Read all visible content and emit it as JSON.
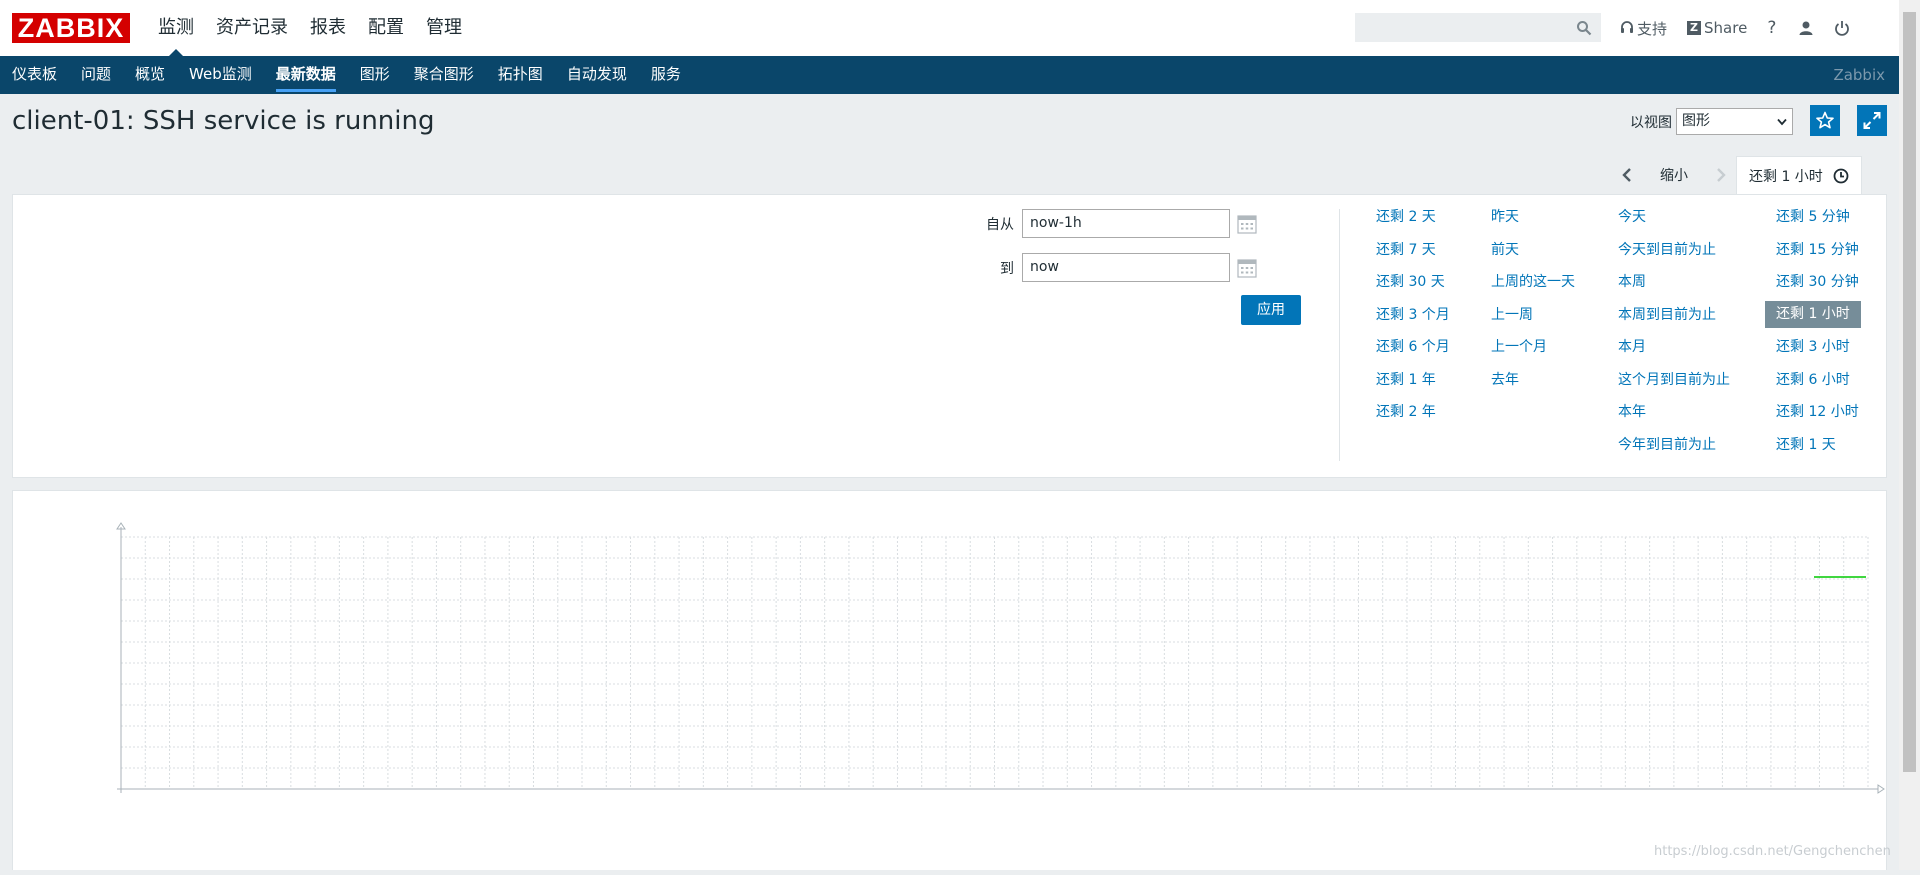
{
  "header": {
    "logo": "ZABBIX",
    "menu": [
      "监测",
      "资产记录",
      "报表",
      "配置",
      "管理"
    ],
    "search_placeholder": "",
    "support_label": "支持",
    "share_label": "Share",
    "help_label": "?"
  },
  "subnav": {
    "items": [
      "仪表板",
      "问题",
      "概览",
      "Web监测",
      "最新数据",
      "图形",
      "聚合图形",
      "拓扑图",
      "自动发现",
      "服务"
    ],
    "active": "最新数据",
    "brand": "Zabbix"
  },
  "page": {
    "title": "client-01: SSH service is running",
    "view_as_label": "以视图",
    "view_as_value": "图形"
  },
  "timenav": {
    "zoom_out": "缩小",
    "active_tab": "还剩 1 小时"
  },
  "filter": {
    "from_label": "自从",
    "from_value": "now-1h",
    "to_label": "到",
    "to_value": "now",
    "apply_label": "应用",
    "quick_ranges": [
      [
        "还剩 2 天",
        "还剩 7 天",
        "还剩 30 天",
        "还剩 3 个月",
        "还剩 6 个月",
        "还剩 1 年",
        "还剩 2 年"
      ],
      [
        "昨天",
        "前天",
        "上周的这一天",
        "上一周",
        "上一个月",
        "去年"
      ],
      [
        "今天",
        "今天到目前为止",
        "本周",
        "本周到目前为止",
        "本月",
        "这个月到目前为止",
        "本年",
        "今年到目前为止"
      ],
      [
        "还剩 5 分钟",
        "还剩 15 分钟",
        "还剩 30 分钟",
        "还剩 1 小时",
        "还剩 3 小时",
        "还剩 6 小时",
        "还剩 12 小时",
        "还剩 1 天"
      ]
    ],
    "selected_range": "还剩 1 小时"
  },
  "watermark": "https://blog.csdn.net/Gengchenchen",
  "colors": {
    "brand_red": "#d40000",
    "nav_blue": "#0a466a",
    "link_blue": "#0275b8",
    "series_green": "#00c800"
  }
}
